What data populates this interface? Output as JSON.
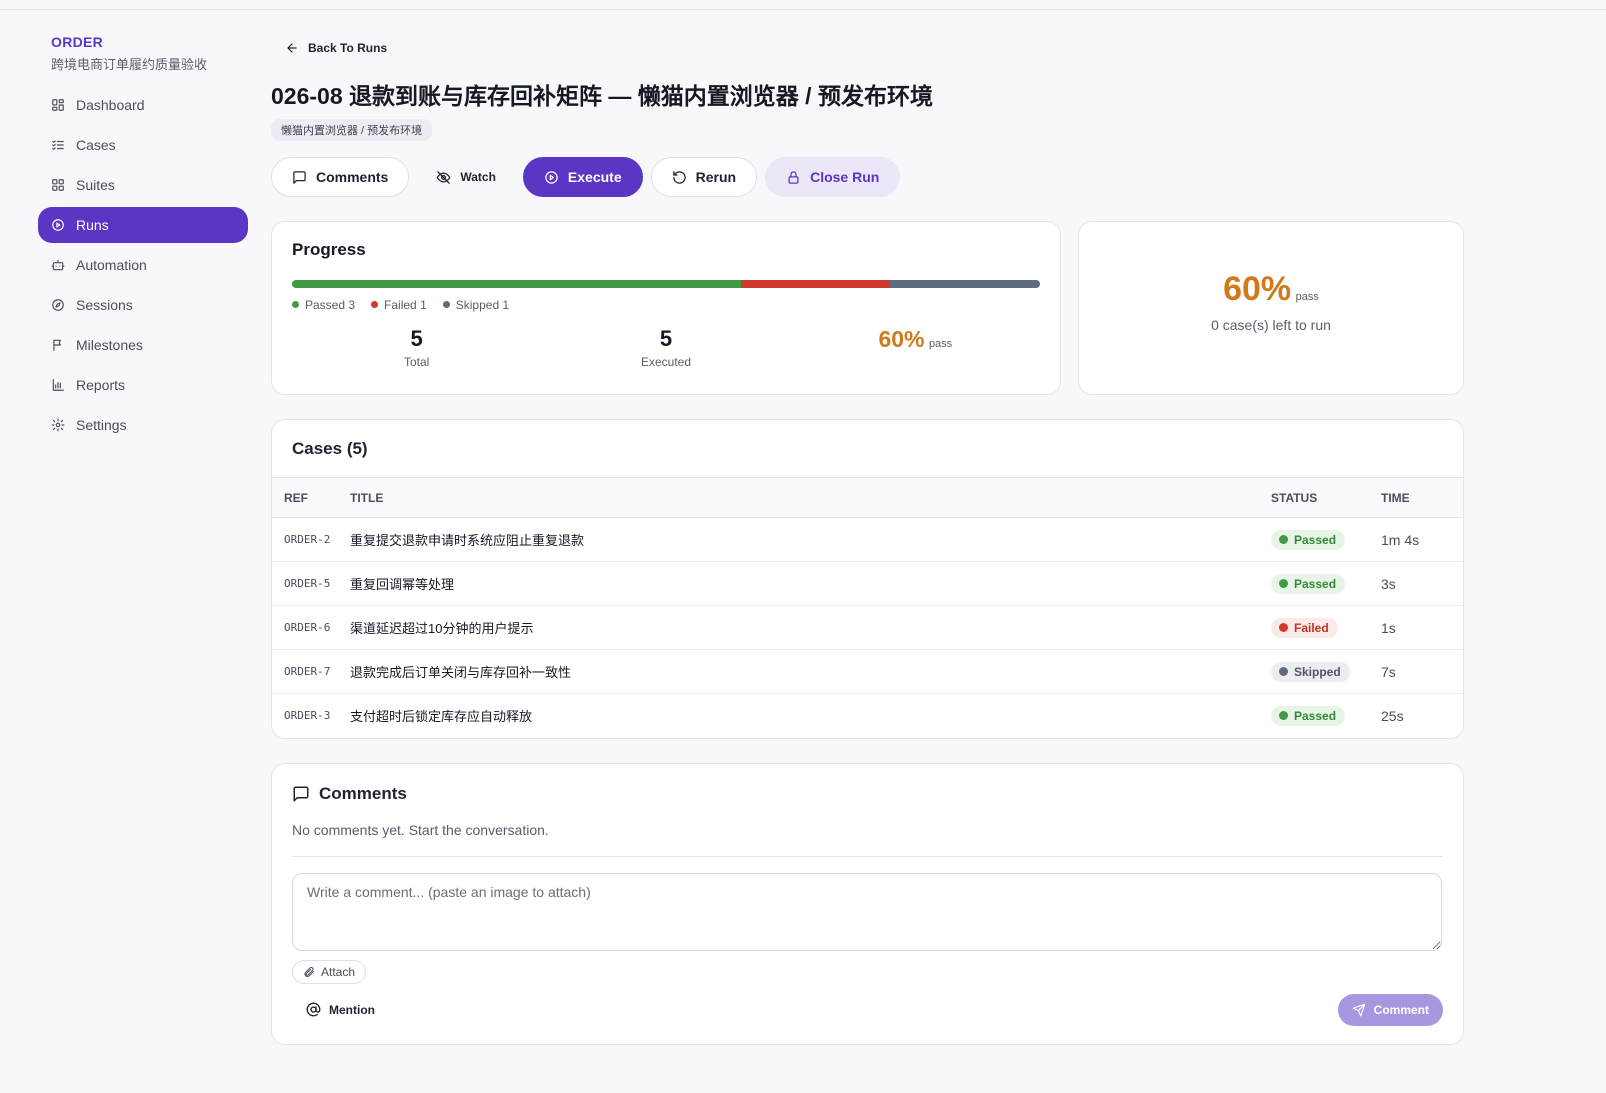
{
  "brand": {
    "name": "ORDER",
    "subtitle": "跨境电商订单履约质量验收"
  },
  "sidebar": {
    "items": [
      {
        "label": "Dashboard",
        "icon": "dashboard-icon"
      },
      {
        "label": "Cases",
        "icon": "checklist-icon"
      },
      {
        "label": "Suites",
        "icon": "grid-icon"
      },
      {
        "label": "Runs",
        "icon": "play-circle-icon",
        "active": true
      },
      {
        "label": "Automation",
        "icon": "bot-icon"
      },
      {
        "label": "Sessions",
        "icon": "compass-icon"
      },
      {
        "label": "Milestones",
        "icon": "flag-icon"
      },
      {
        "label": "Reports",
        "icon": "bar-chart-icon"
      },
      {
        "label": "Settings",
        "icon": "gear-icon"
      }
    ]
  },
  "header": {
    "back_label": "Back To Runs",
    "title": "026-08 退款到账与库存回补矩阵 — 懒猫内置浏览器 / 预发布环境",
    "tag": "懒猫内置浏览器 / 预发布环境"
  },
  "actions": {
    "comments": "Comments",
    "watch": "Watch",
    "execute": "Execute",
    "rerun": "Rerun",
    "close_run": "Close Run"
  },
  "progress": {
    "title": "Progress",
    "passed": 3,
    "failed": 1,
    "skipped": 1,
    "legend_passed": "Passed 3",
    "legend_failed": "Failed 1",
    "legend_skipped": "Skipped 1",
    "total_value": "5",
    "total_label": "Total",
    "executed_value": "5",
    "executed_label": "Executed",
    "pass_pct": "60%",
    "pass_label": "pass"
  },
  "summary": {
    "pass_pct": "60%",
    "pass_label": "pass",
    "left_text": "0 case(s) left to run"
  },
  "cases": {
    "title": "Cases (5)",
    "columns": {
      "ref": "REF",
      "title": "TITLE",
      "status": "STATUS",
      "time": "TIME"
    },
    "rows": [
      {
        "ref": "ORDER-2",
        "title": "重复提交退款申请时系统应阻止重复退款",
        "status": "Passed",
        "kind": "pass",
        "time": "1m 4s"
      },
      {
        "ref": "ORDER-5",
        "title": "重复回调幂等处理",
        "status": "Passed",
        "kind": "pass",
        "time": "3s"
      },
      {
        "ref": "ORDER-6",
        "title": "渠道延迟超过10分钟的用户提示",
        "status": "Failed",
        "kind": "fail",
        "time": "1s"
      },
      {
        "ref": "ORDER-7",
        "title": "退款完成后订单关闭与库存回补一致性",
        "status": "Skipped",
        "kind": "skip",
        "time": "7s"
      },
      {
        "ref": "ORDER-3",
        "title": "支付超时后锁定库存应自动释放",
        "status": "Passed",
        "kind": "pass",
        "time": "25s"
      }
    ]
  },
  "comments": {
    "title": "Comments",
    "empty_text": "No comments yet. Start the conversation.",
    "placeholder": "Write a comment... (paste an image to attach)",
    "attach_label": "Attach",
    "mention_label": "Mention",
    "submit_label": "Comment"
  },
  "colors": {
    "accent": "#5b35c4",
    "passed": "#3f9a43",
    "failed": "#cf3a2a",
    "skipped": "#5e6a80",
    "pass_pct": "#d07a1c"
  }
}
